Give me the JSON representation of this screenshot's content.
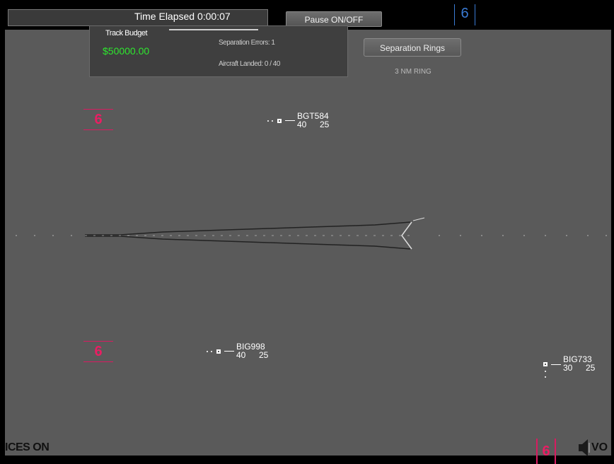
{
  "header": {
    "time_label": "Time Elapsed  0:00:07",
    "pause_label": "Pause ON/OFF",
    "sector_count": "6"
  },
  "budget": {
    "title": "Track Budget",
    "value": "$50000.00",
    "line1": "Separation Errors: 1",
    "line2": "Aircraft Landed: 0 / 40"
  },
  "controls": {
    "separation_label": "Separation Rings",
    "nm_label": "3 NM RING"
  },
  "markers": {
    "left_top": "6",
    "left_bottom": "6",
    "bottom_right": "6"
  },
  "aircraft": [
    {
      "callsign": "BGT584",
      "alt": "40",
      "speed": "25"
    },
    {
      "callsign": "BIG998",
      "alt": "40",
      "speed": "25"
    },
    {
      "callsign": "BIG733",
      "alt": "30",
      "speed": "25"
    }
  ],
  "footer": {
    "voices_label": "ICES ON",
    "volume_label": "VO"
  },
  "colors": {
    "background": "#5a5a5a",
    "budget_green": "#2ee62e",
    "sector_blue": "#3a7bd5",
    "marker_pink": "#e91e63"
  },
  "icons": {
    "speaker": "speaker-icon",
    "aircraft": "aircraft-symbol-icon",
    "runway": "runway-approach-icon"
  }
}
